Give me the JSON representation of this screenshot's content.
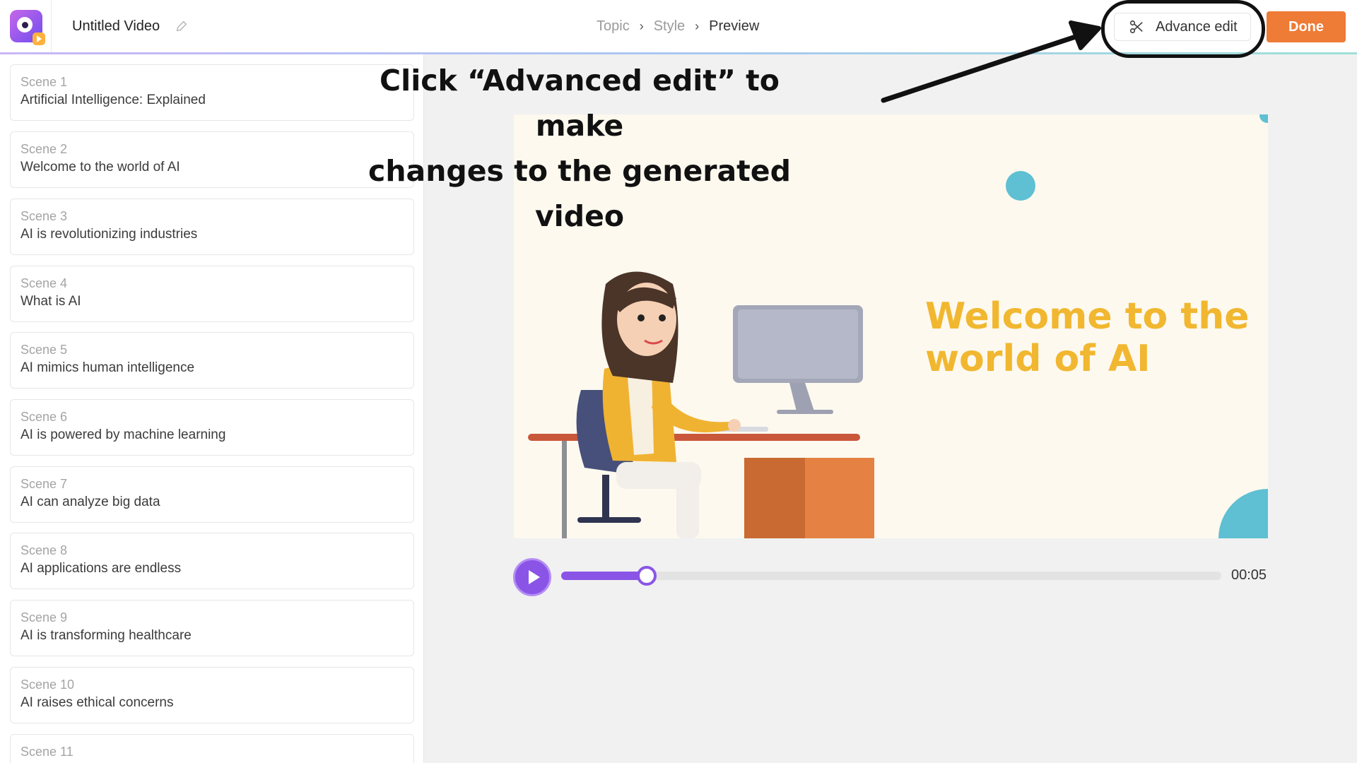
{
  "header": {
    "video_title": "Untitled Video",
    "breadcrumb": [
      "Topic",
      "Style",
      "Preview"
    ],
    "advance_edit_label": "Advance edit",
    "done_label": "Done"
  },
  "scenes": [
    {
      "num": "Scene 1",
      "title": "Artificial Intelligence: Explained"
    },
    {
      "num": "Scene 2",
      "title": "Welcome to the world of AI"
    },
    {
      "num": "Scene 3",
      "title": "AI is revolutionizing industries"
    },
    {
      "num": "Scene 4",
      "title": "What is AI"
    },
    {
      "num": "Scene 5",
      "title": "AI mimics human intelligence"
    },
    {
      "num": "Scene 6",
      "title": "AI is powered by machine learning"
    },
    {
      "num": "Scene 7",
      "title": "AI can analyze big data"
    },
    {
      "num": "Scene 8",
      "title": "AI applications are endless"
    },
    {
      "num": "Scene 9",
      "title": "AI is transforming healthcare"
    },
    {
      "num": "Scene 10",
      "title": "AI raises ethical concerns"
    },
    {
      "num": "Scene 11",
      "title": ""
    }
  ],
  "preview": {
    "headline_line1": "Welcome to the",
    "headline_line2": "world of AI"
  },
  "player": {
    "time": "00:05",
    "progress_fraction": 0.13
  },
  "annotation": {
    "line1": "Click “Advanced edit” to make",
    "line2": "changes to the generated video"
  },
  "colors": {
    "accent_purple": "#8a55e6",
    "done_orange": "#ee7b36",
    "headline_yellow": "#f1b730",
    "teal": "#5ec0d2"
  },
  "icons": [
    "app-logo-icon",
    "pencil-icon",
    "chevron-right-icon",
    "scissors-icon",
    "play-icon"
  ]
}
